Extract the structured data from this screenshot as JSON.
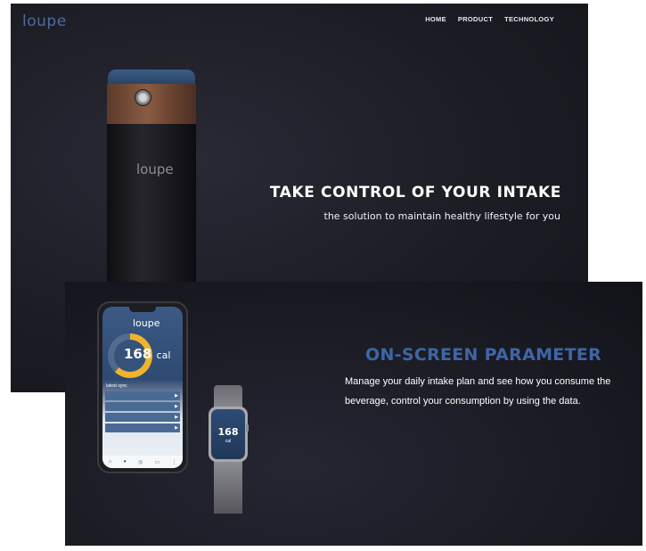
{
  "hero": {
    "logo": "loupe",
    "nav": [
      "HOME",
      "PRODUCT",
      "TECHNOLOGY"
    ],
    "bottle_brand": "loupe",
    "headline": "TAKE CONTROL OF YOUR INTAKE",
    "subheadline": "the solution to maintain healthy lifestyle for you"
  },
  "feature": {
    "title": "ON-SCREEN PARAMETER",
    "description": "Manage your daily intake plan and see how you consume the beverage, control your consumption by using the data.",
    "phone": {
      "app_logo": "loupe",
      "calories": "168",
      "calorie_unit": "cal",
      "calorie_progress": 0.62,
      "ring_color": "#f0b32e",
      "latest_sync_label": "latest sync",
      "dock_icons": [
        "home-icon",
        "user-icon",
        "target-icon",
        "chart-icon",
        "more-icon"
      ]
    },
    "watch": {
      "calories": "168",
      "unit": "cal"
    }
  },
  "colors": {
    "accent_blue": "#3e66a6",
    "hero_bg": "#1c1c24"
  }
}
